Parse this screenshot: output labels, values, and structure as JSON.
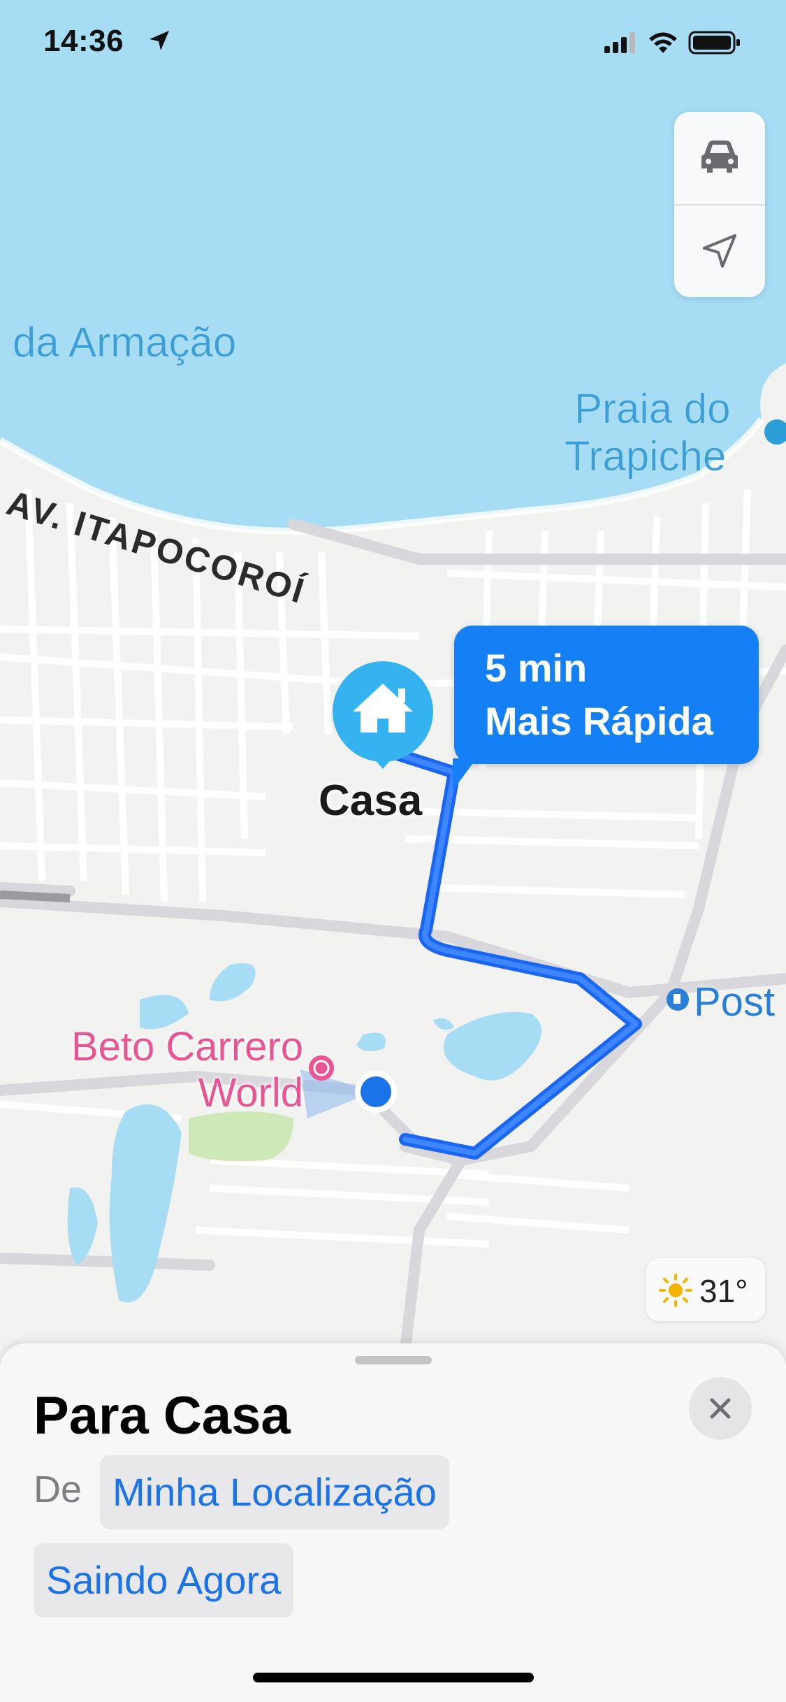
{
  "status_bar": {
    "time": "14:36",
    "location_icon": "location-arrow-icon",
    "signal_icon": "cellular-signal-icon",
    "wifi_icon": "wifi-icon",
    "battery_icon": "battery-icon"
  },
  "map_controls": {
    "mode_icon": "car-icon",
    "locate_icon": "location-arrow-icon"
  },
  "map": {
    "water_labels": [
      "da Armação",
      "Praia do",
      "Trapiche"
    ],
    "street_label": "AV. ITAPOCOROÍ",
    "poi_park": {
      "line1": "Beto Carrero",
      "line2": "World",
      "icon": "ferris-wheel-icon"
    },
    "poi_fuel": {
      "label": "Post",
      "icon": "fuel-icon"
    },
    "destination": {
      "label": "Casa",
      "icon": "house-icon"
    },
    "colors": {
      "water": "#a6ddf5",
      "land": "#f2f2f0",
      "route": "#1a66f2",
      "poi_pink": "#e85592",
      "accent": "#1580f5"
    }
  },
  "route_callout": {
    "time": "5 min",
    "label": "Mais Rápida"
  },
  "weather": {
    "icon": "sun-icon",
    "temperature": "31°"
  },
  "sheet": {
    "title": "Para Casa",
    "from_label": "De",
    "origin": "Minha Localização",
    "departure": "Saindo Agora",
    "close_icon": "close-icon"
  }
}
